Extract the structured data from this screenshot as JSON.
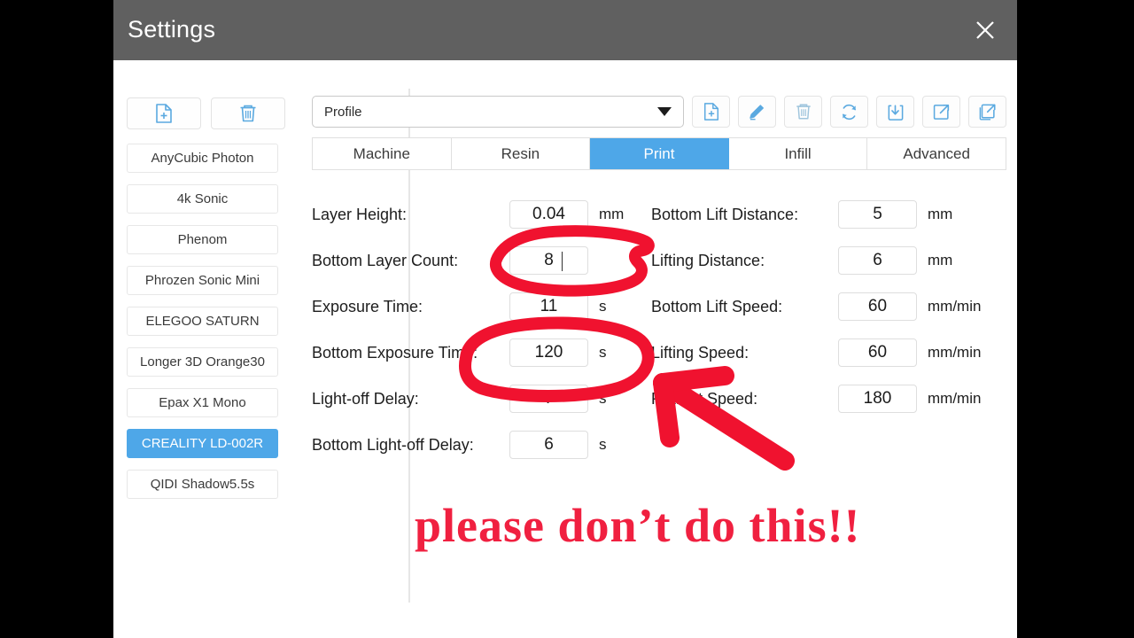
{
  "window": {
    "title": "Settings",
    "close_icon": "close-icon",
    "titlebar_color": "#606060"
  },
  "theme": {
    "accent": "#4ea7e8",
    "annotation_red": "#f02040",
    "text": "#1d1d1d"
  },
  "sidebar": {
    "tools": [
      {
        "name": "new-profile-button",
        "icon": "file-plus-icon"
      },
      {
        "name": "delete-profile-button",
        "icon": "trash-icon"
      }
    ],
    "machines": [
      {
        "label": "AnyCubic Photon",
        "selected": false
      },
      {
        "label": "4k Sonic",
        "selected": false
      },
      {
        "label": "Phenom",
        "selected": false
      },
      {
        "label": "Phrozen Sonic Mini",
        "selected": false
      },
      {
        "label": "ELEGOO SATURN",
        "selected": false
      },
      {
        "label": "Longer 3D Orange30",
        "selected": false
      },
      {
        "label": "Epax X1  Mono",
        "selected": false
      },
      {
        "label": "CREALITY LD-002R",
        "selected": true
      },
      {
        "label": "QIDI Shadow5.5s",
        "selected": false
      }
    ]
  },
  "toolbar": {
    "profile_select": {
      "value": "Profile",
      "caret_icon": "chevron-down-icon"
    },
    "buttons": [
      {
        "name": "add-profile-button",
        "icon": "file-plus-icon"
      },
      {
        "name": "edit-profile-button",
        "icon": "pencil-icon"
      },
      {
        "name": "delete-profile-button",
        "icon": "trash-icon"
      },
      {
        "name": "reset-profile-button",
        "icon": "refresh-icon"
      },
      {
        "name": "import-profile-button",
        "icon": "import-arrow-icon"
      },
      {
        "name": "export-profile-button",
        "icon": "export-arrow-icon"
      },
      {
        "name": "duplicate-profile-button",
        "icon": "copy-export-icon"
      }
    ]
  },
  "tabs": [
    {
      "label": "Machine",
      "active": false
    },
    {
      "label": "Resin",
      "active": false
    },
    {
      "label": "Print",
      "active": true
    },
    {
      "label": "Infill",
      "active": false
    },
    {
      "label": "Advanced",
      "active": false
    }
  ],
  "form": {
    "left_column": [
      {
        "label": "Layer Height:",
        "value": "0.04",
        "unit": "mm",
        "focused": false
      },
      {
        "label": "Bottom Layer Count:",
        "value": "8",
        "unit": "",
        "focused": true
      },
      {
        "label": "Exposure Time:",
        "value": "11",
        "unit": "s",
        "focused": false
      },
      {
        "label": "Bottom Exposure Time:",
        "value": "120",
        "unit": "s",
        "focused": false
      },
      {
        "label": "Light-off Delay:",
        "value": "7",
        "unit": "s",
        "focused": false
      },
      {
        "label": "Bottom Light-off Delay:",
        "value": "6",
        "unit": "s",
        "focused": false
      }
    ],
    "right_column": [
      {
        "label": "Bottom Lift Distance:",
        "value": "5",
        "unit": "mm",
        "focused": false
      },
      {
        "label": "Lifting Distance:",
        "value": "6",
        "unit": "mm",
        "focused": false
      },
      {
        "label": "Bottom Lift Speed:",
        "value": "60",
        "unit": "mm/min",
        "focused": false
      },
      {
        "label": "Lifting Speed:",
        "value": "60",
        "unit": "mm/min",
        "focused": false
      },
      {
        "label": "Retract Speed:",
        "value": "180",
        "unit": "mm/min",
        "focused": false
      }
    ]
  },
  "annotations": {
    "caption": "please don’t do this!!",
    "circle_1_target": "Bottom Layer Count value 8",
    "circle_2_target": "Bottom Exposure Time value 120",
    "arrow_target": "Bottom Exposure Time row"
  }
}
